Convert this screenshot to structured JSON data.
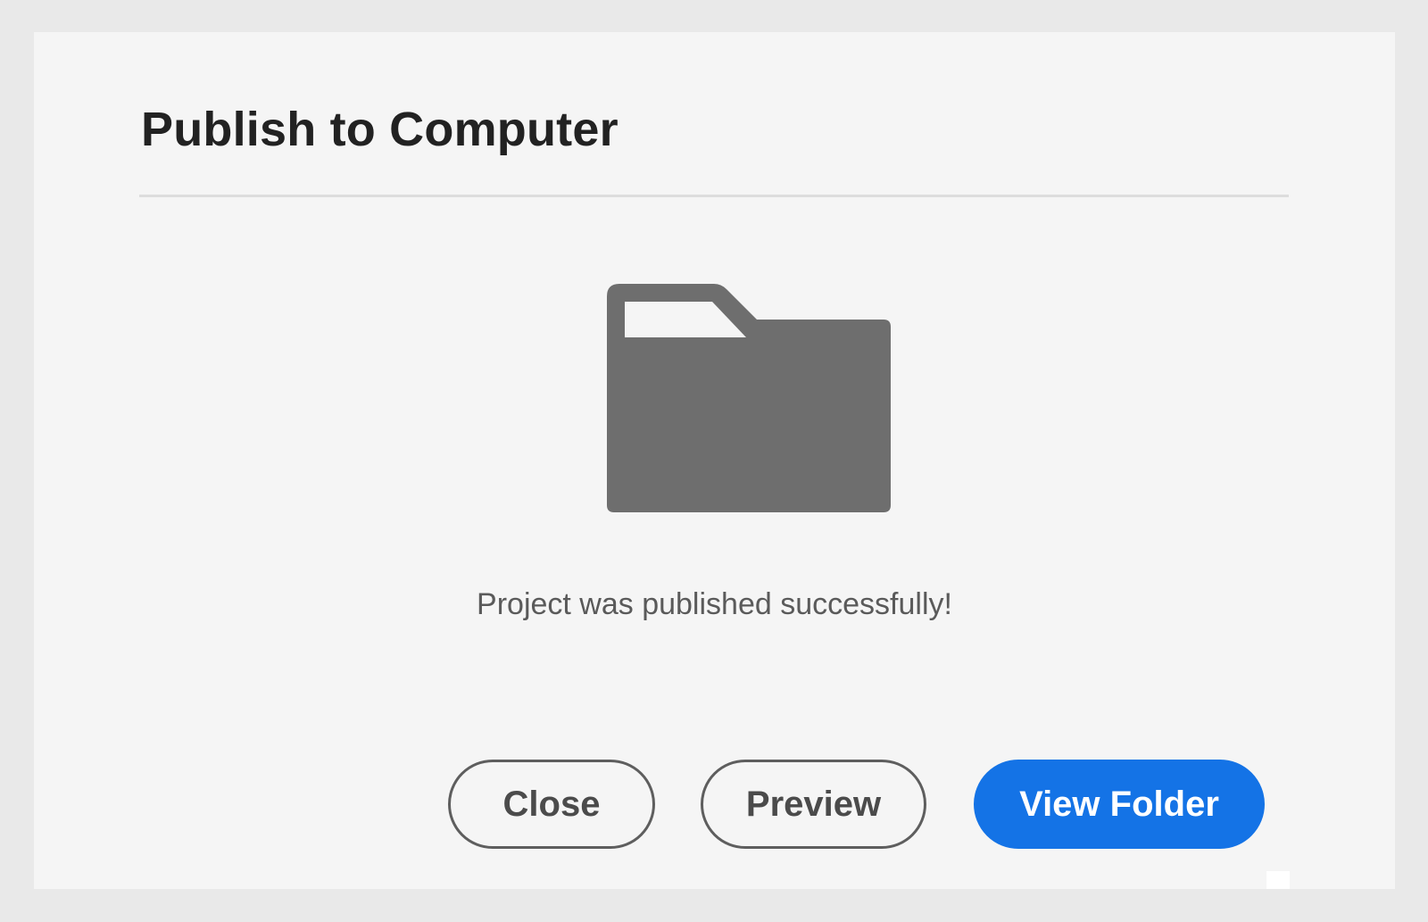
{
  "dialog": {
    "title": "Publish to Computer",
    "icon": "folder-icon",
    "message": "Project was published successfully!",
    "buttons": {
      "close_label": "Close",
      "preview_label": "Preview",
      "view_folder_label": "View Folder"
    }
  },
  "colors": {
    "background": "#e9e9e9",
    "dialog_background": "#f5f5f5",
    "icon": "#6e6e6e",
    "primary": "#1473e6",
    "title_text": "#222222",
    "message_text": "#5a5a5a"
  }
}
